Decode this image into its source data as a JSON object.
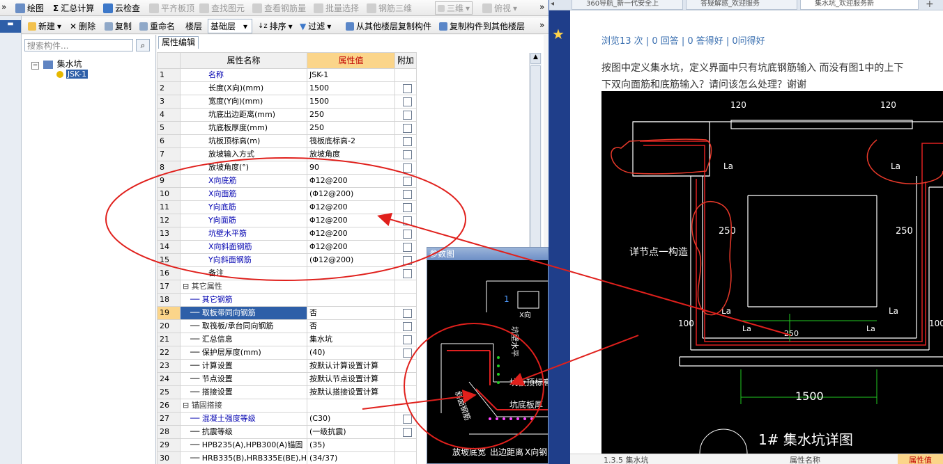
{
  "toolbar1": {
    "items": [
      "绘图",
      "汇总计算",
      "云检查",
      "平齐板顶",
      "查找图元",
      "查看钢筋量",
      "批量选择",
      "钢筋三维"
    ],
    "view_select": "三维",
    "view2": "俯视"
  },
  "toolbar2": {
    "new": "新建",
    "delete": "删除",
    "copy": "复制",
    "rename": "重命名",
    "floor_label": "楼层",
    "floor_value": "基础层",
    "sort": "排序",
    "filter": "过滤",
    "copy_from": "从其他楼层复制构件",
    "copy_to": "复制构件到其他楼层"
  },
  "tree": {
    "search_placeholder": "搜索构件...",
    "root": "集水坑",
    "child": "JSK-1"
  },
  "grid": {
    "tab": "属性编辑",
    "headers": {
      "name": "属性名称",
      "value": "属性值",
      "extra": "附加"
    },
    "rows": [
      {
        "n": "1",
        "name": "名称",
        "value": "JSK-1",
        "blue": true,
        "cb": false
      },
      {
        "n": "2",
        "name": "长度(X向)(mm)",
        "value": "1500",
        "cb": true
      },
      {
        "n": "3",
        "name": "宽度(Y向)(mm)",
        "value": "1500",
        "cb": true
      },
      {
        "n": "4",
        "name": "坑底出边距离(mm)",
        "value": "250",
        "cb": true
      },
      {
        "n": "5",
        "name": "坑底板厚度(mm)",
        "value": "250",
        "cb": true
      },
      {
        "n": "6",
        "name": "坑板顶标高(m)",
        "value": "筏板底标高-2",
        "cb": true
      },
      {
        "n": "7",
        "name": "放坡输入方式",
        "value": "放坡角度",
        "cb": true
      },
      {
        "n": "8",
        "name": "放坡角度(°)",
        "value": "90",
        "cb": true
      },
      {
        "n": "9",
        "name": "X向底筋",
        "value": "Φ12@200",
        "blue": true,
        "cb": true
      },
      {
        "n": "10",
        "name": "X向面筋",
        "value": "(Φ12@200)",
        "blue": true,
        "cb": true
      },
      {
        "n": "11",
        "name": "Y向底筋",
        "value": "Φ12@200",
        "blue": true,
        "cb": true
      },
      {
        "n": "12",
        "name": "Y向面筋",
        "value": "Φ12@200",
        "blue": true,
        "cb": true
      },
      {
        "n": "13",
        "name": "坑壁水平筋",
        "value": "Φ12@200",
        "blue": true,
        "cb": true
      },
      {
        "n": "14",
        "name": "X向斜面钢筋",
        "value": "Φ12@200",
        "blue": true,
        "cb": true
      },
      {
        "n": "15",
        "name": "Y向斜面钢筋",
        "value": "(Φ12@200)",
        "blue": true,
        "cb": true
      },
      {
        "n": "16",
        "name": "备注",
        "value": "",
        "cb": true
      },
      {
        "n": "17",
        "name": "⊟ 其它属性",
        "value": "",
        "grp": true,
        "cb": false
      },
      {
        "n": "18",
        "name": "── 其它钢筋",
        "value": "",
        "blue": true,
        "cb": false
      },
      {
        "n": "19",
        "name": "── 取板带同向钢筋",
        "value": "否",
        "sel": true,
        "cb": true
      },
      {
        "n": "20",
        "name": "── 取筏板/承台同向钢筋",
        "value": "否",
        "cb": true
      },
      {
        "n": "21",
        "name": "── 汇总信息",
        "value": "集水坑",
        "cb": true
      },
      {
        "n": "22",
        "name": "── 保护层厚度(mm)",
        "value": "(40)",
        "cb": true
      },
      {
        "n": "23",
        "name": "── 计算设置",
        "value": "按默认计算设置计算",
        "cb": false
      },
      {
        "n": "24",
        "name": "── 节点设置",
        "value": "按默认节点设置计算",
        "cb": false
      },
      {
        "n": "25",
        "name": "── 搭接设置",
        "value": "按默认搭接设置计算",
        "cb": false
      },
      {
        "n": "26",
        "name": "⊟ 锚固搭接",
        "value": "",
        "grp": true,
        "cb": false
      },
      {
        "n": "27",
        "name": "── 混凝土强度等级",
        "value": "(C30)",
        "blue": true,
        "cb": true
      },
      {
        "n": "28",
        "name": "── 抗震等级",
        "value": "(一级抗震)",
        "cb": true
      },
      {
        "n": "29",
        "name": "── HPB235(A),HPB300(A)锚固",
        "value": "(35)",
        "cb": false
      },
      {
        "n": "30",
        "name": "── HRB335(B),HRB335E(BE),HRBF",
        "value": "(34/37)",
        "cb": false
      }
    ]
  },
  "param_window": {
    "title": "参数图",
    "labels": [
      "X向",
      "1",
      "坑板顶标高",
      "坑底板厚",
      "放坡底宽",
      "出边距离",
      "X向钢",
      "坑壁水平",
      "斜面钢筋"
    ]
  },
  "browser": {
    "tabs": [
      "360导航_新一代安全上",
      "答疑解惑_欢迎服务",
      "集水坑_欢迎服务新"
    ],
    "stats": "浏览13 次 | 0 回答 | 0 答得好 | 0问得好",
    "question_line1": "按图中定义集水坑，定义界面中只有坑底钢筋输入 而没有图1中的上下",
    "question_line2": "下双向面筋和底筋输入？请问该怎么处理？谢谢",
    "cad_labels": {
      "dim_top_left": "120",
      "dim_top_right": "120",
      "la1": "La",
      "la2": "La",
      "d250_left": "250",
      "d250_right": "250",
      "detail": "详节点一构造",
      "la3": "La",
      "la4": "La",
      "la5": "La",
      "la6": "La",
      "d100_left": "100",
      "d100_right": "100",
      "d250_mid": "250",
      "width": "1500",
      "title": "1# 集水坑详图"
    },
    "bottom_left": "1.3.5 集水坑",
    "bottom_mid": "属性名称",
    "bottom_right": "属性值"
  }
}
